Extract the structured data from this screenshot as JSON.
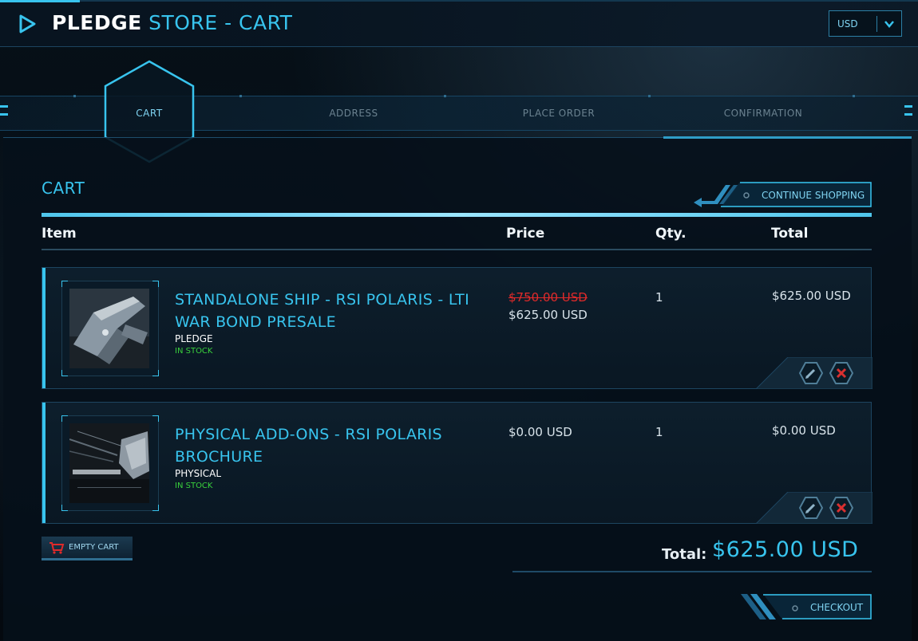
{
  "header": {
    "title_part1": "PLEDGE",
    "title_part2": "STORE - CART",
    "currency": {
      "selected": "USD"
    }
  },
  "steps": [
    {
      "label": "CART",
      "active": true
    },
    {
      "label": "ADDRESS",
      "active": false
    },
    {
      "label": "PLACE ORDER",
      "active": false
    },
    {
      "label": "CONFIRMATION",
      "active": false
    }
  ],
  "cart": {
    "title": "CART",
    "continue_label": "CONTINUE SHOPPING",
    "columns": {
      "item": "Item",
      "price": "Price",
      "qty": "Qty.",
      "total": "Total"
    },
    "items": [
      {
        "name": "STANDALONE SHIP - RSI POLARIS - LTI WAR BOND PRESALE",
        "type": "PLEDGE",
        "stock": "IN STOCK",
        "price_original": "$750.00 USD",
        "price": "$625.00 USD",
        "qty": "1",
        "total": "$625.00 USD"
      },
      {
        "name": "PHYSICAL ADD-ONS - RSI POLARIS BROCHURE",
        "type": "PHYSICAL",
        "stock": "IN STOCK",
        "price": "$0.00 USD",
        "qty": "1",
        "total": "$0.00 USD"
      }
    ],
    "empty_label": "EMPTY CART",
    "grand_total_label": "Total:",
    "grand_total": "$625.00 USD",
    "checkout_label": "CHECKOUT"
  },
  "colors": {
    "accent": "#38c4ee",
    "strike": "#e02a2a",
    "stock": "#39d13c",
    "background": "#050b12"
  }
}
